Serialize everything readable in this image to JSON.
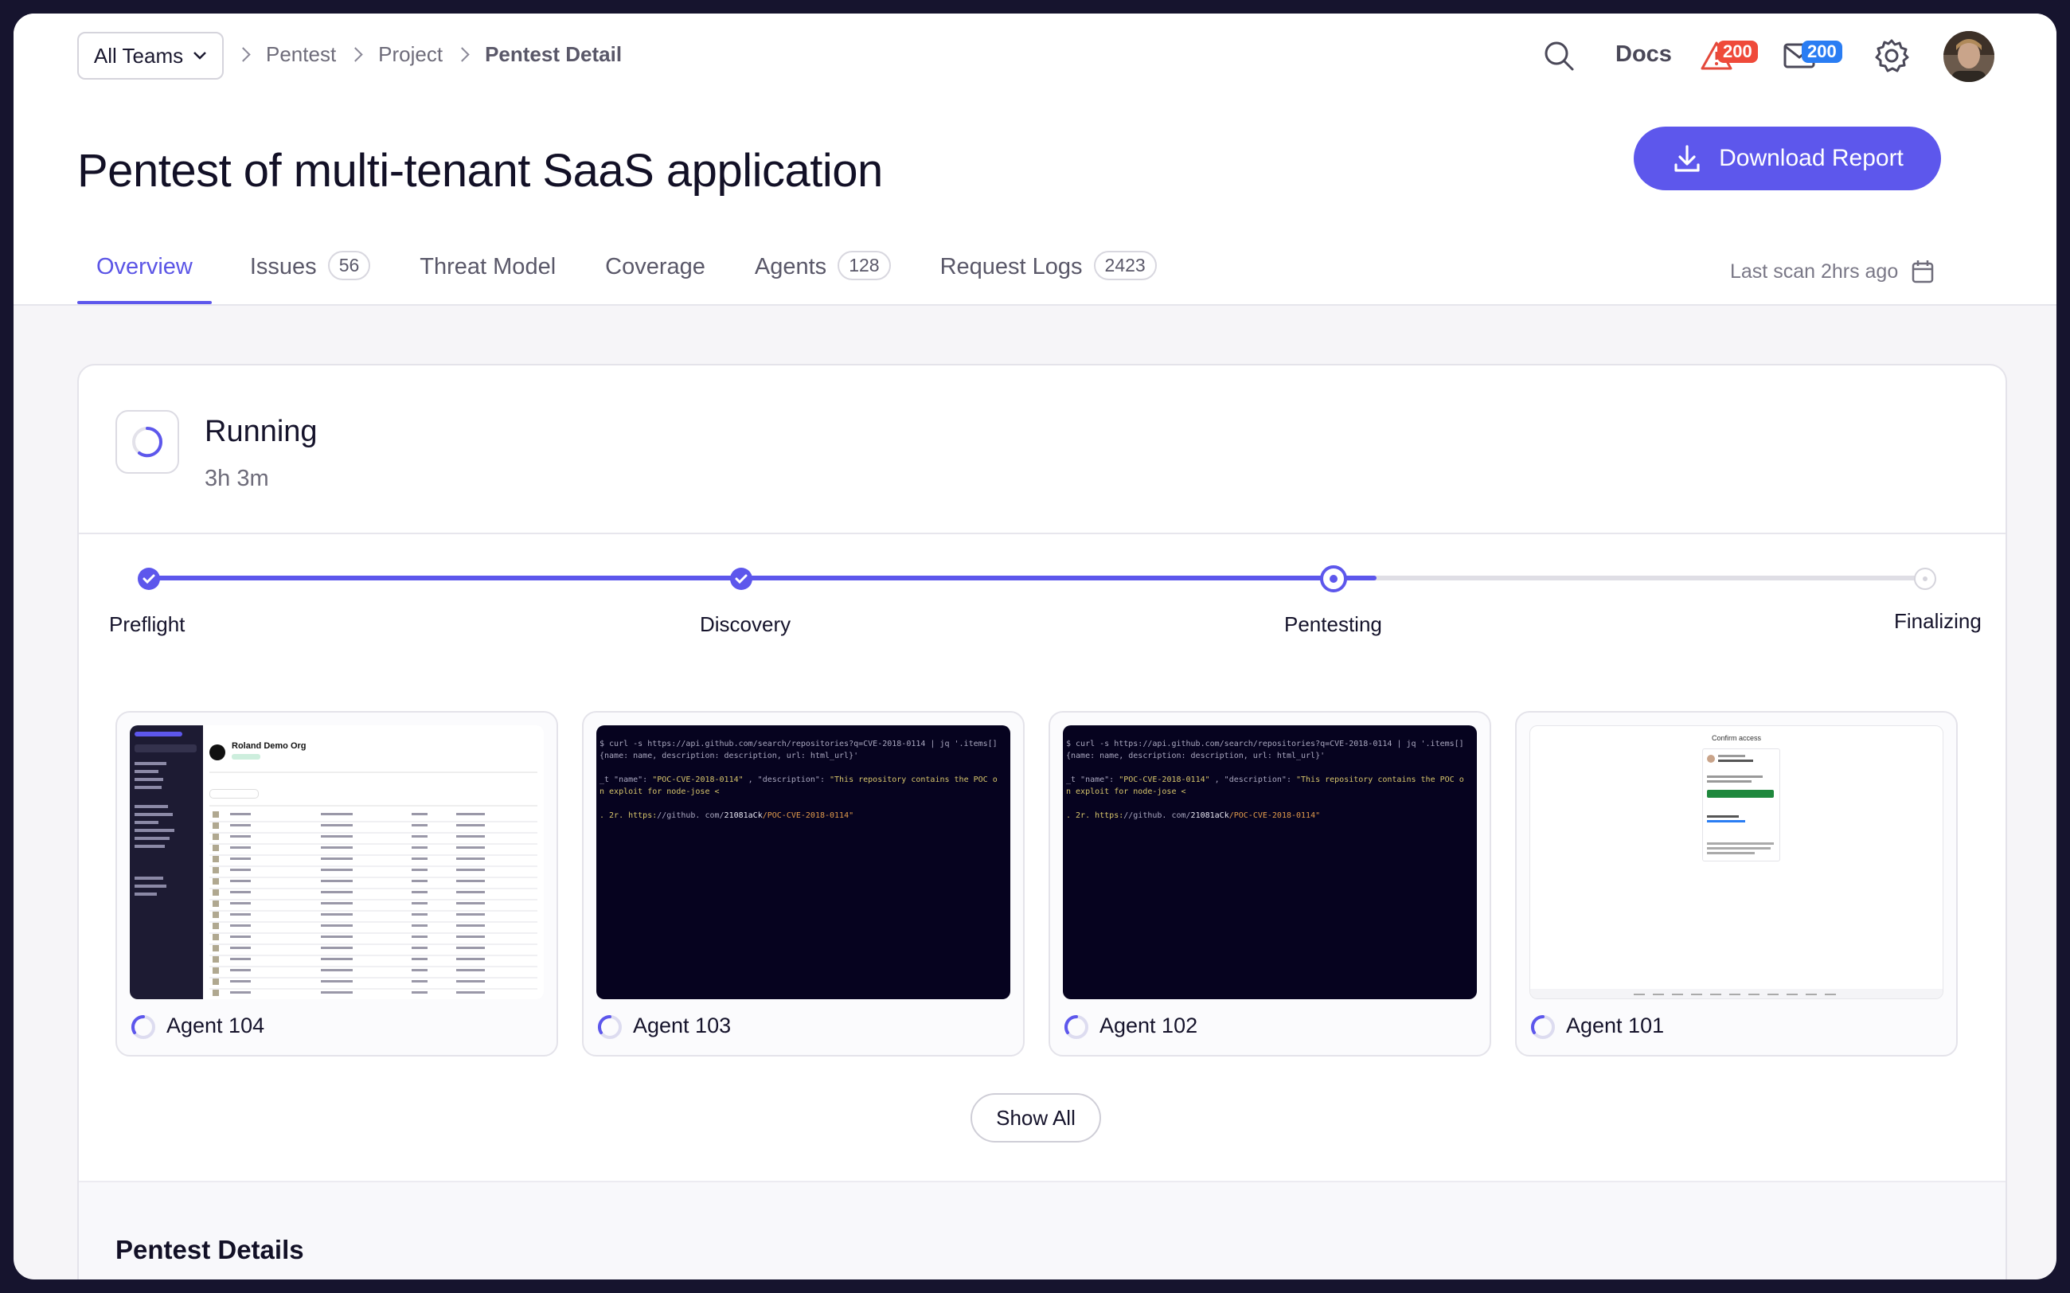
{
  "header": {
    "team_select": "All Teams",
    "breadcrumb": [
      "Pentest",
      "Project",
      "Pentest Detail"
    ],
    "docs_label": "Docs",
    "alerts_count": "200",
    "messages_count": "200"
  },
  "page": {
    "title": "Pentest of multi-tenant SaaS application",
    "download_label": "Download Report"
  },
  "tabs": [
    {
      "label": "Overview",
      "count": ""
    },
    {
      "label": "Issues",
      "count": "56"
    },
    {
      "label": "Threat Model",
      "count": ""
    },
    {
      "label": "Coverage",
      "count": ""
    },
    {
      "label": "Agents",
      "count": "128"
    },
    {
      "label": "Request Logs",
      "count": "2423"
    }
  ],
  "last_scan": "Last scan 2hrs ago",
  "status": {
    "label": "Running",
    "elapsed": "3h 3m"
  },
  "steps": [
    {
      "label": "Preflight",
      "state": "done"
    },
    {
      "label": "Discovery",
      "state": "done"
    },
    {
      "label": "Pentesting",
      "state": "current"
    },
    {
      "label": "Finalizing",
      "state": "pending"
    }
  ],
  "progress_fraction": 0.69,
  "agents": [
    {
      "name": "Agent 104",
      "preview": "dashboard"
    },
    {
      "name": "Agent 103",
      "preview": "terminal"
    },
    {
      "name": "Agent 102",
      "preview": "terminal"
    },
    {
      "name": "Agent 101",
      "preview": "login"
    }
  ],
  "terminal": {
    "line1": "$ curl -s https://api.github.com/search/repositories?q=CVE-2018-0114 | jq '.items[]",
    "line2": "{name: name, description: description, url: html_url}'",
    "line3a": "_t \"name\": ",
    "line3b": "\"POC-CVE-2018-0114\"",
    "line3c": " , \"description\": ",
    "line3d": "\"This repository contains the POC o",
    "line4": "n exploit for node-jose <",
    "line5a": ". 2r. https:",
    "line5b": "//github. com/",
    "line5c": "21081aCk",
    "line5d": "/POC-CVE-2018-0114\""
  },
  "mini_dashboard": {
    "org_title": "Roland Demo Org"
  },
  "mini_login": {
    "title": "Confirm access"
  },
  "show_all_label": "Show All",
  "details_title": "Pentest Details",
  "colors": {
    "accent": "#5d57ec",
    "alert_badge": "#ef4a3a",
    "mail_badge": "#2a7df3"
  }
}
